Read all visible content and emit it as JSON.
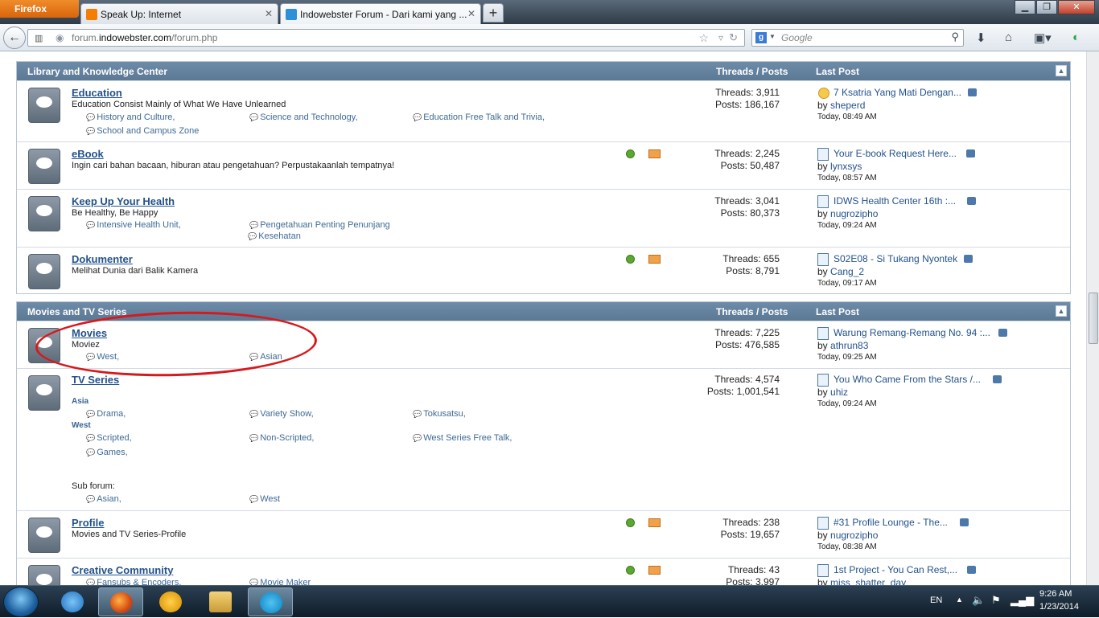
{
  "browser": {
    "app_button": "Firefox",
    "tabs": [
      {
        "label": "Speak Up: Internet",
        "icon": "blogger-icon"
      },
      {
        "label": "Indowebster Forum - Dari kami yang ...",
        "icon": "indowebster-icon"
      }
    ],
    "new_tab": "+",
    "url_prefix": "forum.",
    "url_domain": "indowebster.com",
    "url_path": "/forum.php",
    "search_placeholder": "Google"
  },
  "categories": [
    {
      "title": "Library and Knowledge Center",
      "col_threads_posts": "Threads / Posts",
      "col_last_post": "Last Post",
      "forums": [
        {
          "title": "Education",
          "desc": "Education Consist Mainly of What We Have Unlearned",
          "subs": [
            "History and Culture,",
            "Science and Technology,",
            "Education Free Talk and Trivia,",
            "School and Campus Zone"
          ],
          "threads": "Threads: 3,911",
          "posts": "Posts: 186,167",
          "lp_title": "7 Ksatria Yang Mati Dengan...",
          "lp_by": "by",
          "lp_user": "sheperd",
          "lp_time": "Today, 08:49 AM"
        },
        {
          "title": "eBook",
          "desc": "Ingin cari bahan bacaan, hiburan atau pengetahuan? Perpustakaanlah tempatnya!",
          "threads": "Threads: 2,245",
          "posts": "Posts: 50,487",
          "lp_title": "Your E-book Request Here...",
          "lp_by": "by",
          "lp_user": "lynxsys",
          "lp_time": "Today, 08:57 AM"
        },
        {
          "title": "Keep Up Your Health",
          "desc": "Be Healthy, Be Happy",
          "subs": [
            "Intensive Health Unit,",
            "Pengetahuan Penting Penunjang",
            "Kesehatan"
          ],
          "threads": "Threads: 3,041",
          "posts": "Posts: 80,373",
          "lp_title": "IDWS Health Center 16th :...",
          "lp_by": "by",
          "lp_user": "nugrozipho",
          "lp_time": "Today, 09:24 AM"
        },
        {
          "title": "Dokumenter",
          "desc": "Melihat Dunia dari Balik Kamera",
          "threads": "Threads: 655",
          "posts": "Posts: 8,791",
          "lp_title": "S02E08 - Si Tukang Nyontek",
          "lp_by": "by",
          "lp_user": "Cang_2",
          "lp_time": "Today, 09:17 AM"
        }
      ]
    },
    {
      "title": "Movies and TV Series",
      "col_threads_posts": "Threads / Posts",
      "col_last_post": "Last Post",
      "forums": [
        {
          "title": "Movies",
          "desc": "Moviez",
          "subs": [
            "West,",
            "Asian"
          ],
          "threads": "Threads: 7,225",
          "posts": "Posts: 476,585",
          "lp_title": "Warung Remang-Remang No. 94 :...",
          "lp_by": "by",
          "lp_user": "athrun83",
          "lp_time": "Today, 09:25 AM"
        },
        {
          "title": "TV Series",
          "group_asia": "Asia",
          "group_west": "West",
          "subs_asia": [
            "Drama,",
            "Variety Show,",
            "Tokusatsu,"
          ],
          "subs_west": [
            "Scripted,",
            "Non-Scripted,",
            "West Series Free Talk,",
            "Games,"
          ],
          "subforum_label": "Sub forum:",
          "subforums": [
            "Asian,",
            "West"
          ],
          "threads": "Threads: 4,574",
          "posts": "Posts: 1,001,541",
          "lp_title": "You Who Came From the Stars /...",
          "lp_by": "by",
          "lp_user": "uhiz",
          "lp_time": "Today, 09:24 AM"
        },
        {
          "title": "Profile",
          "desc": "Movies and TV Series-Profile",
          "threads": "Threads: 238",
          "posts": "Posts: 19,657",
          "lp_title": "#31 Profile Lounge - The...",
          "lp_by": "by",
          "lp_user": "nugrozipho",
          "lp_time": "Today, 08:38 AM"
        },
        {
          "title": "Creative Community",
          "subs": [
            "Fansubs & Encoders,",
            "Movie Maker"
          ],
          "threads": "Threads: 43",
          "posts": "Posts: 3,997",
          "lp_title": "1st Project - You Can Rest,...",
          "lp_by": "by",
          "lp_user": "miss_shatter_day"
        }
      ]
    }
  ],
  "taskbar": {
    "lang": "EN",
    "time": "9:26 AM",
    "date": "1/23/2014"
  },
  "colors": {
    "accent": "#5b7895",
    "link": "#23528c",
    "annotation": "#d7191c"
  }
}
